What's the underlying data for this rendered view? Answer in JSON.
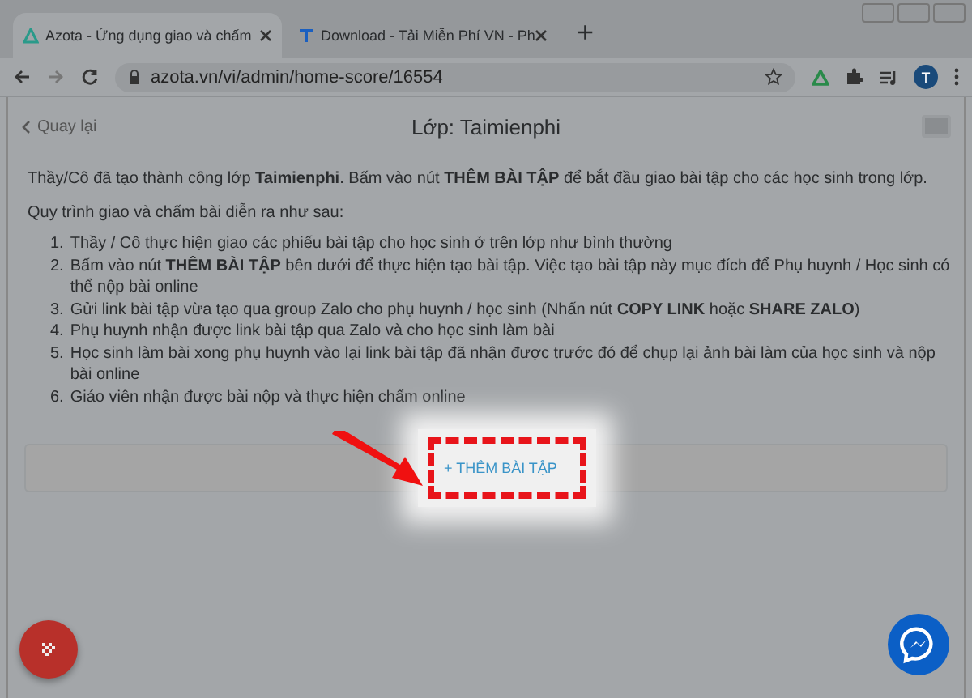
{
  "browser": {
    "tabs": [
      {
        "title": "Azota - Ứng dụng giao và chấm",
        "selected": true
      },
      {
        "title": "Download - Tải Miễn Phí VN - Ph",
        "selected": false
      }
    ],
    "new_tab": "+",
    "url": "azota.vn/vi/admin/home-score/16554",
    "profile": "T"
  },
  "header": {
    "back": "Quay lại",
    "title": "Lớp: Taimienphi"
  },
  "intro": "Thầy/Cô đã tạo thành công lớp **Taimienphi**. Bấm vào nút **THÊM BÀI TẬP** để bắt đầu giao bài tập cho các học sinh trong lớp.",
  "process_title": "Quy trình giao và chấm bài diễn ra như sau:",
  "steps": [
    {
      "number": "1.",
      "text": "Thầy / Cô thực hiện giao các phiếu bài tập cho học sinh ở trên lớp như bình thường"
    },
    {
      "number": "2.",
      "text": "Bấm vào nút **THÊM BÀI TẬP** bên dưới để thực hiện tạo bài tập. Việc tạo bài tập này mục đích để Phụ huynh / Học sinh có thể nộp bài online"
    },
    {
      "number": "3.",
      "text": "Gửi link bài tập vừa tạo qua group Zalo cho phụ huynh / học sinh (Nhấn nút **COPY LINK** hoặc **SHARE ZALO**)"
    },
    {
      "number": "4.",
      "text": "Phụ huynh nhận được link bài tập qua Zalo và cho học sinh làm bài"
    },
    {
      "number": "5.",
      "text": "Học sinh làm bài xong phụ huynh vào lại link bài tập đã nhận được trước đó để chụp lại ảnh bài làm của học sinh và nộp bài online"
    },
    {
      "number": "6.",
      "text": "Giáo viên nhận được bài nộp và thực hiện chấm online"
    }
  ],
  "add_button": "+ THÊM BÀI TẬP"
}
